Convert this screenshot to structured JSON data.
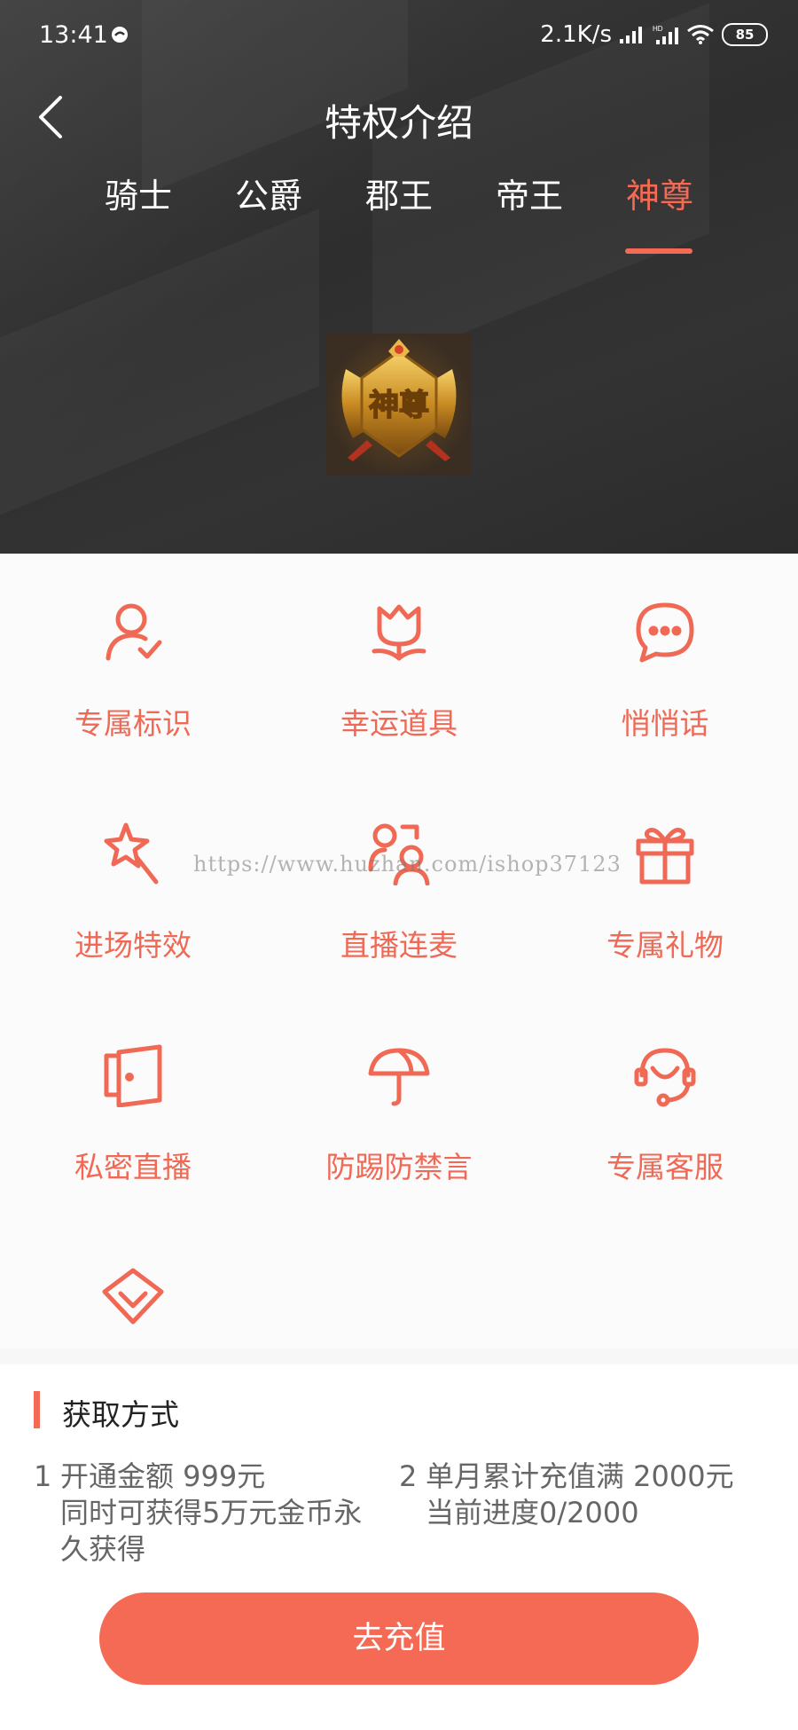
{
  "status_bar": {
    "time": "13:41",
    "net_speed": "2.1K/s",
    "battery": "85"
  },
  "header": {
    "title": "特权介绍"
  },
  "tabs": [
    {
      "label": "骑士"
    },
    {
      "label": "公爵"
    },
    {
      "label": "郡王"
    },
    {
      "label": "帝王"
    },
    {
      "label": "神尊",
      "active": true
    }
  ],
  "badge": {
    "text": "神尊"
  },
  "privileges": [
    {
      "label": "专属标识",
      "icon": "user-check-icon"
    },
    {
      "label": "幸运道具",
      "icon": "tulip-icon"
    },
    {
      "label": "悄悄话",
      "icon": "chat-bubble-icon"
    },
    {
      "label": "进场特效",
      "icon": "magic-wand-icon"
    },
    {
      "label": "直播连麦",
      "icon": "two-users-icon"
    },
    {
      "label": "专属礼物",
      "icon": "gift-icon"
    },
    {
      "label": "私密直播",
      "icon": "door-icon"
    },
    {
      "label": "防踢防禁言",
      "icon": "umbrella-icon"
    },
    {
      "label": "专属客服",
      "icon": "headset-icon"
    },
    {
      "label": "",
      "icon": "diamond-icon"
    }
  ],
  "watermark": "https://www.huzhan.com/ishop37123",
  "acquisition": {
    "title": "获取方式",
    "methods": [
      {
        "num": "1",
        "line1": "开通金额 999元",
        "line2": "同时可获得5万元金币永",
        "line3": "久获得"
      },
      {
        "num": "2",
        "line1": "单月累计充值满 2000元",
        "line2": "当前进度0/2000"
      }
    ]
  },
  "recharge_button": "去充值",
  "colors": {
    "accent": "#f46a55",
    "header_bg": "#333333"
  }
}
